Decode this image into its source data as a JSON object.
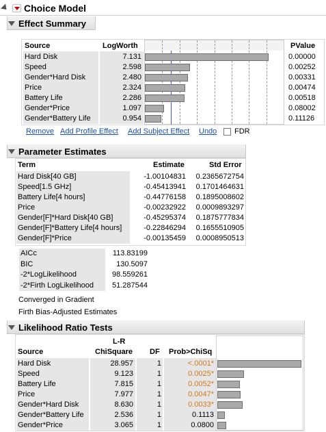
{
  "app": {
    "title": "Choice Model"
  },
  "effect_summary": {
    "title": "Effect Summary",
    "headers": {
      "source": "Source",
      "logworth": "LogWorth",
      "pvalue": "PValue"
    },
    "rows": [
      {
        "source": "Hard Disk",
        "logworth": "7.131",
        "pvalue": "0.00000",
        "value": 7.131
      },
      {
        "source": "Speed",
        "logworth": "2.598",
        "pvalue": "0.00252",
        "value": 2.598
      },
      {
        "source": "Gender*Hard Disk",
        "logworth": "2.480",
        "pvalue": "0.00331",
        "value": 2.48
      },
      {
        "source": "Price",
        "logworth": "2.324",
        "pvalue": "0.00474",
        "value": 2.324
      },
      {
        "source": "Battery Life",
        "logworth": "2.286",
        "pvalue": "0.00518",
        "value": 2.286
      },
      {
        "source": "Gender*Price",
        "logworth": "1.097",
        "pvalue": "0.08002",
        "value": 1.097
      },
      {
        "source": "Gender*Battery Life",
        "logworth": "0.954",
        "pvalue": "0.11126",
        "value": 0.954
      }
    ],
    "buttons": {
      "remove": "Remove",
      "add_profile": "Add Profile Effect",
      "add_subject": "Add Subject Effect",
      "undo": "Undo",
      "fdr": "FDR"
    }
  },
  "parameter_estimates": {
    "title": "Parameter Estimates",
    "headers": {
      "term": "Term",
      "estimate": "Estimate",
      "std_error": "Std Error"
    },
    "rows": [
      {
        "term": "Hard Disk[40 GB]",
        "estimate": "-1.00104831",
        "std_error": "0.2365672754"
      },
      {
        "term": "Speed[1.5 GHz]",
        "estimate": "-0.45413941",
        "std_error": "0.1701464631"
      },
      {
        "term": "Battery Life[4 hours]",
        "estimate": "-0.44776158",
        "std_error": "0.1895008602"
      },
      {
        "term": "Price",
        "estimate": "-0.00232922",
        "std_error": "0.0009893297"
      },
      {
        "term": "Gender[F]*Hard Disk[40 GB]",
        "estimate": "-0.45295374",
        "std_error": "0.1875777834"
      },
      {
        "term": "Gender[F]*Battery Life[4 hours]",
        "estimate": "-0.22846294",
        "std_error": "0.1655510905"
      },
      {
        "term": "Gender[F]*Price",
        "estimate": "-0.00135459",
        "std_error": "0.0008950513"
      }
    ],
    "stats": [
      {
        "label": "AICc",
        "value": "113.83199"
      },
      {
        "label": "BIC",
        "value": "130.5097"
      },
      {
        "label": "-2*LogLikelihood",
        "value": "98.559261"
      },
      {
        "label": "-2*Firth LogLikelihood",
        "value": "51.287544"
      }
    ],
    "notes": [
      "Converged in Gradient",
      "Firth Bias-Adjusted Estimates"
    ]
  },
  "likelihood_ratio": {
    "title": "Likelihood Ratio Tests",
    "headers": {
      "source": "Source",
      "chisq_top": "L-R",
      "chisq_bottom": "ChiSquare",
      "df": "DF",
      "prob": "Prob>ChiSq"
    },
    "rows": [
      {
        "source": "Hard Disk",
        "chisq": "28.957",
        "df": "1",
        "prob": "<.0001*",
        "sig": true,
        "value": 28.957
      },
      {
        "source": "Speed",
        "chisq": "9.123",
        "df": "1",
        "prob": "0.0025*",
        "sig": true,
        "value": 9.123
      },
      {
        "source": "Battery Life",
        "chisq": "7.815",
        "df": "1",
        "prob": "0.0052*",
        "sig": true,
        "value": 7.815
      },
      {
        "source": "Price",
        "chisq": "7.977",
        "df": "1",
        "prob": "0.0047*",
        "sig": true,
        "value": 7.977
      },
      {
        "source": "Gender*Hard Disk",
        "chisq": "8.630",
        "df": "1",
        "prob": "0.0033*",
        "sig": true,
        "value": 8.63
      },
      {
        "source": "Gender*Battery Life",
        "chisq": "2.536",
        "df": "1",
        "prob": "0.1113",
        "sig": false,
        "value": 2.536
      },
      {
        "source": "Gender*Price",
        "chisq": "3.065",
        "df": "1",
        "prob": "0.0800",
        "sig": false,
        "value": 3.065
      }
    ]
  },
  "colors": {
    "significant": "#d0781e",
    "link": "#1a4fb5",
    "bar_fill": "#a9a9a9",
    "reference_line": "#3a5fcd"
  }
}
